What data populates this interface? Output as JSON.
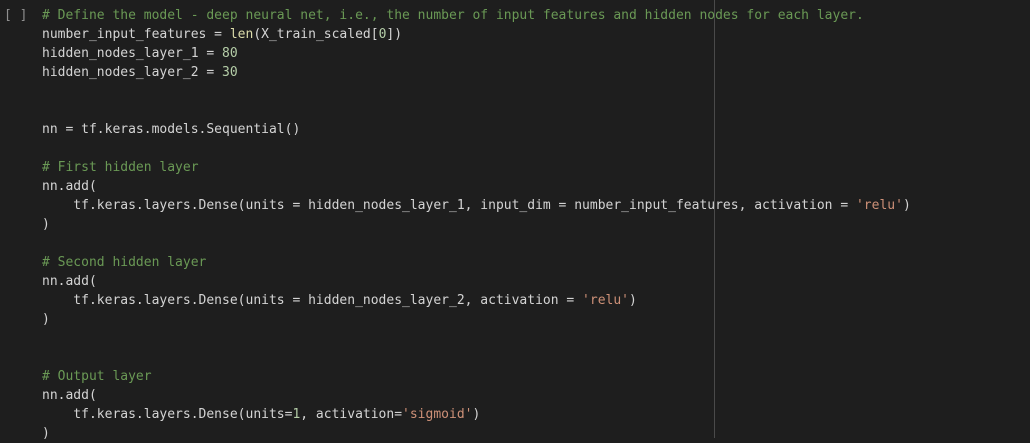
{
  "cell": {
    "run_indicator": "[ ]",
    "colors": {
      "background": "#1e1e1e",
      "default_text": "#d4d4d4",
      "comment": "#6a9955",
      "number": "#b5cea8",
      "string": "#ce9178",
      "builtin": "#dcdcaa"
    },
    "lines": [
      [
        {
          "t": "comment",
          "v": "# Define the model - deep neural net, i.e., the number of input features and hidden nodes for each layer."
        }
      ],
      [
        {
          "t": "default",
          "v": "number_input_features = "
        },
        {
          "t": "builtin",
          "v": "len"
        },
        {
          "t": "default",
          "v": "(X_train_scaled["
        },
        {
          "t": "number",
          "v": "0"
        },
        {
          "t": "default",
          "v": "])"
        }
      ],
      [
        {
          "t": "default",
          "v": "hidden_nodes_layer_1 = "
        },
        {
          "t": "number",
          "v": "80"
        }
      ],
      [
        {
          "t": "default",
          "v": "hidden_nodes_layer_2 = "
        },
        {
          "t": "number",
          "v": "30"
        }
      ],
      [],
      [],
      [
        {
          "t": "default",
          "v": "nn = tf.keras.models.Sequential()"
        }
      ],
      [],
      [
        {
          "t": "comment",
          "v": "# First hidden layer"
        }
      ],
      [
        {
          "t": "default",
          "v": "nn.add("
        }
      ],
      [
        {
          "t": "default",
          "v": "    tf.keras.layers.Dense(units = hidden_nodes_layer_1, input_dim = number_input_features, activation = "
        },
        {
          "t": "string",
          "v": "'relu'"
        },
        {
          "t": "default",
          "v": ")"
        }
      ],
      [
        {
          "t": "default",
          "v": ")"
        }
      ],
      [],
      [
        {
          "t": "comment",
          "v": "# Second hidden layer"
        }
      ],
      [
        {
          "t": "default",
          "v": "nn.add("
        }
      ],
      [
        {
          "t": "default",
          "v": "    tf.keras.layers.Dense(units = hidden_nodes_layer_2, activation = "
        },
        {
          "t": "string",
          "v": "'relu'"
        },
        {
          "t": "default",
          "v": ")"
        }
      ],
      [
        {
          "t": "default",
          "v": ")"
        }
      ],
      [],
      [],
      [
        {
          "t": "comment",
          "v": "# Output layer"
        }
      ],
      [
        {
          "t": "default",
          "v": "nn.add("
        }
      ],
      [
        {
          "t": "default",
          "v": "    tf.keras.layers.Dense(units="
        },
        {
          "t": "number",
          "v": "1"
        },
        {
          "t": "default",
          "v": ", activation="
        },
        {
          "t": "string",
          "v": "'sigmoid'"
        },
        {
          "t": "default",
          "v": ")"
        }
      ],
      [
        {
          "t": "default",
          "v": ")"
        }
      ]
    ]
  }
}
